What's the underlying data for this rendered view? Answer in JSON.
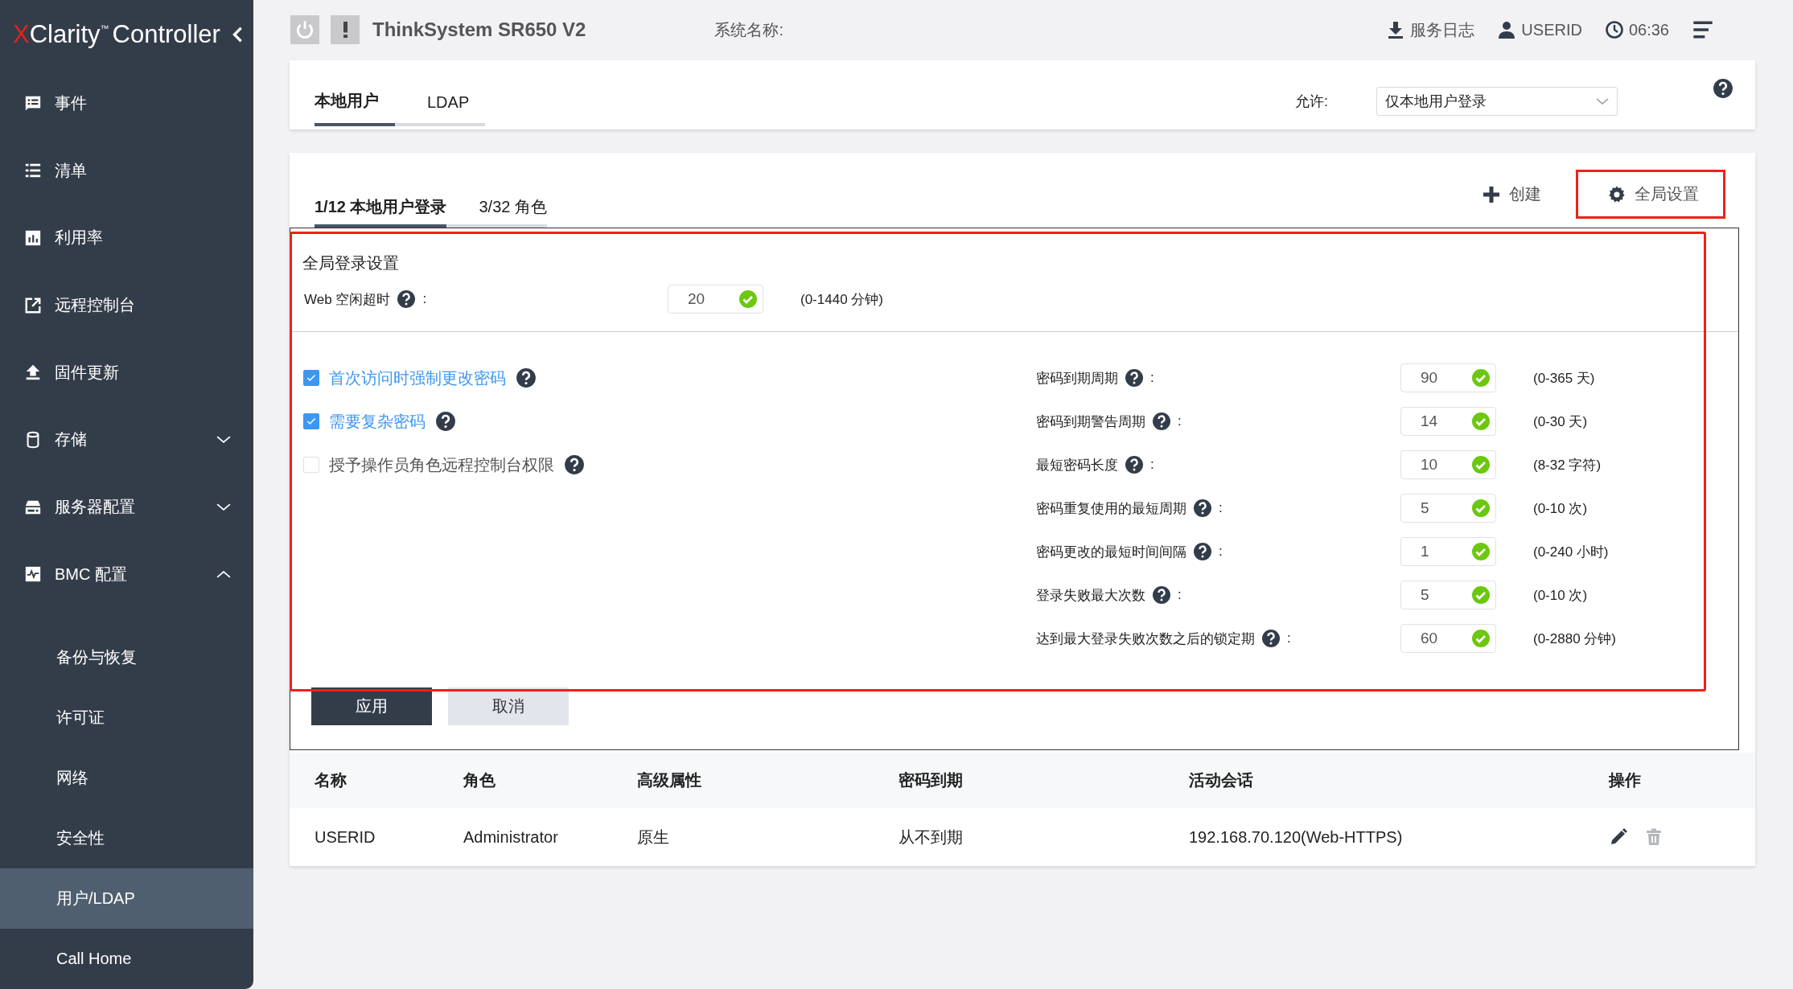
{
  "sidebar": {
    "logo": {
      "mark": "X",
      "name": "Clarity",
      "tm": "™",
      "product": "Controller"
    },
    "items": [
      {
        "label": "事件",
        "kind": "link",
        "selected": false
      },
      {
        "label": "清单",
        "kind": "link",
        "selected": false
      },
      {
        "label": "利用率",
        "kind": "link",
        "selected": false
      },
      {
        "label": "远程控制台",
        "kind": "link",
        "selected": false
      },
      {
        "label": "固件更新",
        "kind": "link",
        "selected": false
      },
      {
        "label": "存储",
        "kind": "group",
        "expanded": false,
        "selected": false
      },
      {
        "label": "服务器配置",
        "kind": "group",
        "expanded": false,
        "selected": false
      },
      {
        "label": "BMC 配置",
        "kind": "group",
        "expanded": true,
        "selected": false,
        "children": [
          {
            "label": "备份与恢复",
            "selected": false
          },
          {
            "label": "许可证",
            "selected": false
          },
          {
            "label": "网络",
            "selected": false
          },
          {
            "label": "安全性",
            "selected": false
          },
          {
            "label": "用户/LDAP",
            "selected": true
          },
          {
            "label": "Call Home",
            "selected": false
          }
        ]
      }
    ]
  },
  "topbar": {
    "title": "ThinkSystem SR650 V2",
    "system_name_label": "系统名称:",
    "service_log": "服务日志",
    "user": "USERID",
    "time": "06:36"
  },
  "tabs": [
    {
      "label": "本地用户",
      "selected": true
    },
    {
      "label": "LDAP",
      "selected": false
    }
  ],
  "allow": {
    "label": "允许:",
    "value": "仅本地用户登录"
  },
  "subtabs": [
    {
      "label": "1/12 本地用户登录",
      "selected": true
    },
    {
      "label": "3/32 角色",
      "selected": false
    }
  ],
  "actions": [
    {
      "kind": "create",
      "label": "创建",
      "highlighted": false
    },
    {
      "kind": "settings",
      "label": "全局设置",
      "highlighted": true
    }
  ],
  "global_settings": {
    "title": "全局登录设置",
    "highlighted": true,
    "web_timeout": {
      "label": "Web 空闲超时",
      "colon": ":",
      "value": "20",
      "range": "(0-1440 分钟)"
    },
    "checkboxes": [
      {
        "label": "首次访问时强制更改密码",
        "checked": true
      },
      {
        "label": "需要复杂密码",
        "checked": true
      },
      {
        "label": "授予操作员角色远程控制台权限",
        "checked": false
      }
    ],
    "fields": [
      {
        "label": "密码到期周期",
        "colon": ":",
        "value": "90",
        "range": "(0-365 天)"
      },
      {
        "label": "密码到期警告周期",
        "colon": ":",
        "value": "14",
        "range": "(0-30 天)"
      },
      {
        "label": "最短密码长度",
        "colon": ":",
        "value": "10",
        "range": "(8-32 字符)"
      },
      {
        "label": "密码重复使用的最短周期",
        "colon": ":",
        "value": "5",
        "range": "(0-10 次)"
      },
      {
        "label": "密码更改的最短时间间隔",
        "colon": ":",
        "value": "1",
        "range": "(0-240 小时)"
      },
      {
        "label": "登录失败最大次数",
        "colon": ":",
        "value": "5",
        "range": "(0-10 次)"
      },
      {
        "label": "达到最大登录失败次数之后的锁定期",
        "colon": ":",
        "value": "60",
        "range": "(0-2880 分钟)"
      }
    ],
    "buttons": [
      {
        "kind": "primary",
        "label": "应用"
      },
      {
        "kind": "secondary",
        "label": "取消"
      }
    ]
  },
  "table": {
    "columns": [
      "名称",
      "角色",
      "高级属性",
      "密码到期",
      "活动会话",
      "操作"
    ],
    "rows": [
      {
        "cells": [
          "USERID",
          "Administrator",
          "原生",
          "从不到期",
          "192.168.70.120(Web-HTTPS)"
        ],
        "actions": [
          {
            "kind": "edit",
            "disabled": false
          },
          {
            "kind": "delete",
            "disabled": true
          }
        ]
      }
    ]
  }
}
